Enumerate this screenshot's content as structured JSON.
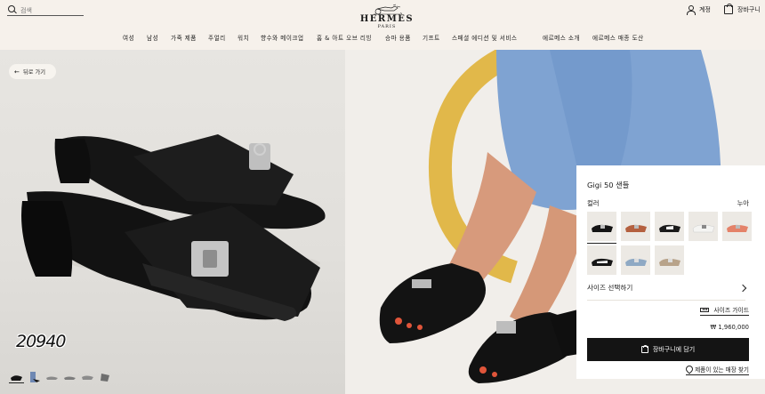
{
  "header": {
    "search_placeholder": "검색",
    "brand": "HERMÈS",
    "brand_city": "PARIS",
    "account_label": "계정",
    "cart_label": "장바구니"
  },
  "nav": [
    "여성",
    "남성",
    "가죽 제품",
    "주얼리",
    "워치",
    "향수와 메이크업",
    "홈 & 아트 오브 리빙",
    "승마 용품",
    "기프트",
    "스페셜 에디션 및 서비스",
    "에르메스 소개",
    "에르메스 매종 도산"
  ],
  "back_label": "뒤로 가기",
  "product_number": "20940",
  "product": {
    "title": "Gigi 50 샌들",
    "color_label": "컬러",
    "color_value": "누아",
    "size_label": "사이즈 선택하기",
    "size_guide": "사이즈 가이드",
    "price": "₩ 1,960,000",
    "add_to_cart": "장바구니에 담기",
    "store_link": "제품이 있는 매장 찾기"
  },
  "swatch_colors": [
    "black",
    "tan",
    "black-white",
    "white",
    "coral",
    "black2",
    "lightblue",
    "beige"
  ]
}
